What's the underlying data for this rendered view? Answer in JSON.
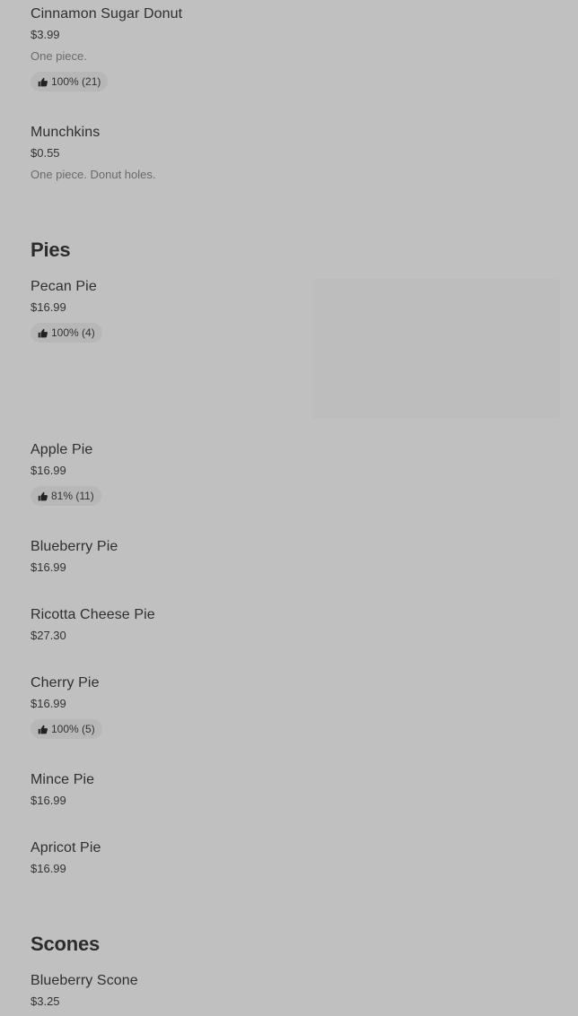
{
  "items_top": [
    {
      "name": "Cinnamon Sugar Donut",
      "price": "$3.99",
      "desc": "One piece.",
      "rating": "100% (21)"
    },
    {
      "name": "Munchkins",
      "price": "$0.55",
      "desc": "One piece. Donut holes."
    }
  ],
  "sections": {
    "pies": {
      "title": "Pies",
      "items": [
        {
          "name": "Pecan Pie",
          "price": "$16.99",
          "rating": "100% (4)"
        },
        {
          "name": "Apple Pie",
          "price": "$16.99",
          "rating": "81% (11)"
        },
        {
          "name": "Blueberry Pie",
          "price": "$16.99"
        },
        {
          "name": "Ricotta Cheese Pie",
          "price": "$27.30"
        },
        {
          "name": "Cherry Pie",
          "price": "$16.99",
          "rating": "100% (5)"
        },
        {
          "name": "Mince Pie",
          "price": "$16.99"
        },
        {
          "name": "Apricot Pie",
          "price": "$16.99"
        }
      ]
    },
    "scones": {
      "title": "Scones",
      "items": [
        {
          "name": "Blueberry Scone",
          "price": "$3.25"
        }
      ]
    }
  },
  "icons": {
    "rating": "thumbs-up-icon"
  }
}
